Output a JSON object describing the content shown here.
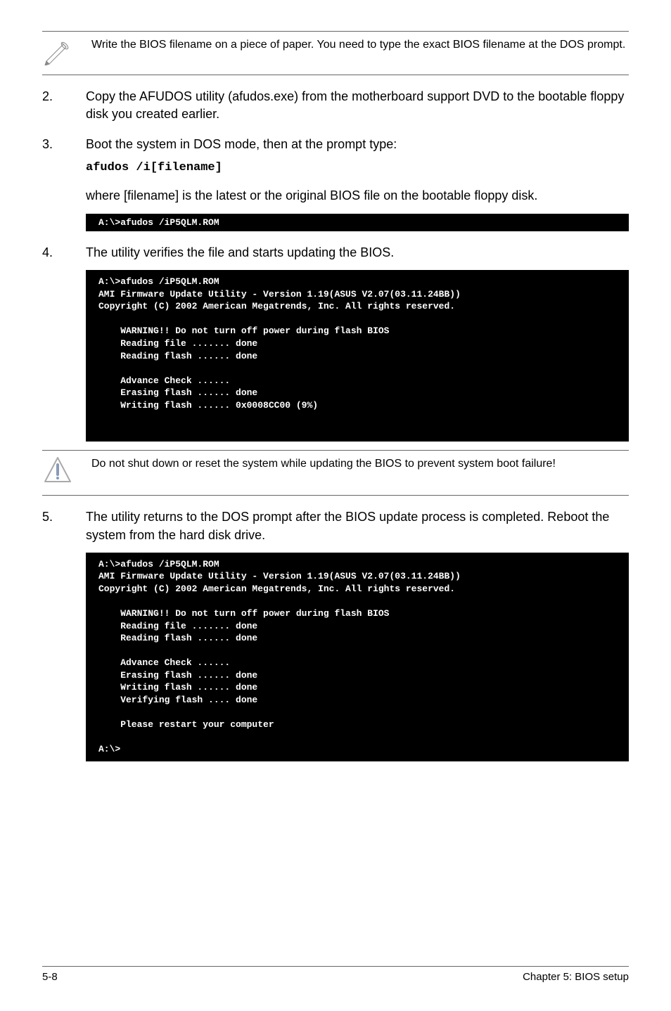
{
  "note1": {
    "text": "Write the BIOS filename on a piece of paper. You need to type the exact BIOS filename at the DOS prompt."
  },
  "steps": {
    "s2": {
      "num": "2.",
      "text": "Copy the AFUDOS utility (afudos.exe) from the motherboard support DVD to the bootable floppy disk you created earlier."
    },
    "s3": {
      "num": "3.",
      "text": "Boot the system in DOS mode, then at the prompt type:",
      "code": "afudos /i[filename]"
    },
    "s3b": "where [filename] is the latest or the original BIOS file on the bootable floppy disk.",
    "s4": {
      "num": "4.",
      "text": "The utility verifies the file and starts updating the BIOS."
    },
    "s5": {
      "num": "5.",
      "text": "The utility returns to the DOS prompt after the BIOS update process is completed. Reboot the system from the hard disk drive."
    }
  },
  "terminal1": "A:\\>afudos /iP5QLM.ROM",
  "terminal2": "A:\\>afudos /iP5QLM.ROM\nAMI Firmware Update Utility - Version 1.19(ASUS V2.07(03.11.24BB))\nCopyright (C) 2002 American Megatrends, Inc. All rights reserved.\n\n    WARNING!! Do not turn off power during flash BIOS\n    Reading file ....... done\n    Reading flash ...... done\n\n    Advance Check ......\n    Erasing flash ...... done\n    Writing flash ...... 0x0008CC00 (9%)\n\n\n",
  "terminal3": "A:\\>afudos /iP5QLM.ROM\nAMI Firmware Update Utility - Version 1.19(ASUS V2.07(03.11.24BB))\nCopyright (C) 2002 American Megatrends, Inc. All rights reserved.\n\n    WARNING!! Do not turn off power during flash BIOS\n    Reading file ....... done\n    Reading flash ...... done\n\n    Advance Check ......\n    Erasing flash ...... done\n    Writing flash ...... done\n    Verifying flash .... done\n\n    Please restart your computer\n\nA:\\>",
  "caution": {
    "text": "Do not shut down or reset the system while updating the BIOS to prevent system boot failure!"
  },
  "footer": {
    "left": "5-8",
    "right": "Chapter 5: BIOS setup"
  }
}
